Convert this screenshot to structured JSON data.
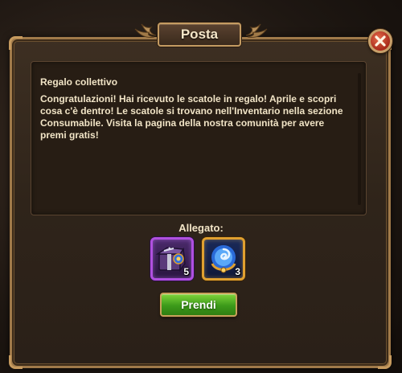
{
  "dialog": {
    "title": "Posta",
    "close_icon": "close-x-icon"
  },
  "message": {
    "title": "Regalo collettivo",
    "body": "Congratulazioni! Hai ricevuto le scatole in regalo! Aprile e scopri cosa c'è dentro! Le scatole si trovano nell'Inventario nella sezione Consumabile. Visita la pagina della nostra comunità per avere premi gratis!"
  },
  "attachments": {
    "label": "Allegato:",
    "items": [
      {
        "icon": "gift-chest-icon",
        "quantity": "5",
        "frame_color": "#b050e0"
      },
      {
        "icon": "swirl-orb-icon",
        "quantity": "3",
        "frame_color": "#e0a030"
      }
    ]
  },
  "actions": {
    "take_label": "Prendi"
  },
  "colors": {
    "frame_gold": "#c69a5e",
    "text_cream": "#f1e4c6",
    "button_green": "#3c9a1a",
    "close_red": "#a82a1a"
  }
}
